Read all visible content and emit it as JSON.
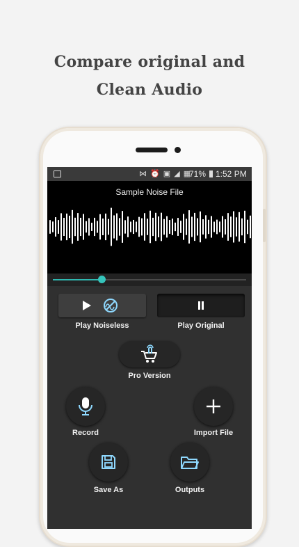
{
  "headline": {
    "line1": "Compare original and",
    "line2": "Clean Audio"
  },
  "status_bar": {
    "status_icons": "⋈ ⏰ ▣ ◢ ▦",
    "battery": "71%",
    "time": "1:52 PM"
  },
  "player": {
    "file_title": "Sample Noise File",
    "progress_fraction": 0.25
  },
  "controls": {
    "play_noiseless_label": "Play Noiseless",
    "play_original_label": "Play Original",
    "pro_version_label": "Pro Version",
    "record_label": "Record",
    "import_file_label": "Import File",
    "save_as_label": "Save As",
    "outputs_label": "Outputs"
  },
  "colors": {
    "accent": "#35c4bb",
    "icon_accent": "#8fd9ff",
    "screen_bg": "#303030",
    "wave_bg": "#000000",
    "wave_bar": "#ffffff"
  },
  "icons": {
    "play": "play-icon",
    "noiseless": "noise-off-icon",
    "pause": "pause-icon",
    "pro": "cart-icon",
    "record": "microphone-icon",
    "import": "plus-icon",
    "save": "save-icon",
    "outputs": "folder-icon"
  }
}
